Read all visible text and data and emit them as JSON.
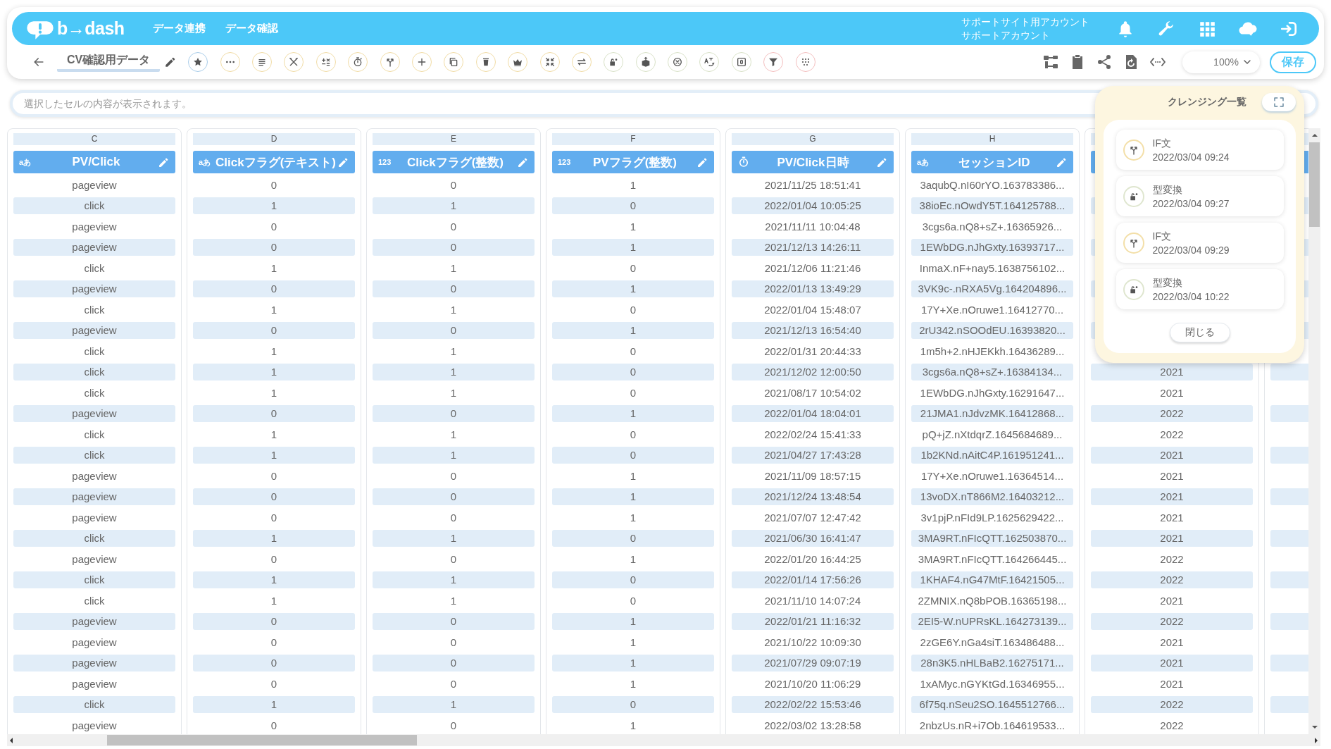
{
  "header": {
    "logo": "b→dash",
    "nav": [
      {
        "label": "データ連携"
      },
      {
        "label": "データ確認"
      }
    ],
    "account": [
      "サポートサイト用アカウント",
      "サポートアカウント"
    ]
  },
  "toolbar": {
    "title": "CV確認用データ",
    "tools": [
      {
        "color": "#a9cdea"
      },
      {
        "color": "#f1dca6"
      },
      {
        "color": "#f1dca6"
      },
      {
        "color": "#f1dca6"
      },
      {
        "color": "#f1dca6"
      },
      {
        "color": "#f1dca6"
      },
      {
        "color": "#f1dca6"
      },
      {
        "color": "#f1dca6"
      },
      {
        "color": "#f1dca6"
      },
      {
        "color": "#f1dca6"
      },
      {
        "color": "#f1dca6"
      },
      {
        "color": "#f1dca6"
      },
      {
        "color": "#f1dca6"
      },
      {
        "color": "#d9e2c8"
      },
      {
        "color": "#d9e2c8"
      },
      {
        "color": "#d9e2c8"
      },
      {
        "color": "#d9e2c8"
      },
      {
        "color": "#d9e2c8"
      },
      {
        "color": "#f4c0c0"
      },
      {
        "color": "#f4c0c0"
      }
    ],
    "zoom": "100%",
    "save": "保存"
  },
  "cell_viewer": {
    "placeholder": "選択したセルの内容が表示されます。"
  },
  "table": {
    "columns": [
      {
        "letter": "C",
        "name": "PV/Click",
        "type_mark": "aあ",
        "cells": [
          "pageview",
          "click",
          "pageview",
          "pageview",
          "click",
          "pageview",
          "click",
          "pageview",
          "click",
          "click",
          "click",
          "pageview",
          "click",
          "click",
          "pageview",
          "pageview",
          "pageview",
          "click",
          "pageview",
          "click",
          "click",
          "pageview",
          "pageview",
          "pageview",
          "pageview",
          "click",
          "pageview"
        ]
      },
      {
        "letter": "D",
        "name": "Clickフラグ(テキスト)",
        "type_mark": "aあ",
        "cells": [
          "0",
          "1",
          "0",
          "0",
          "1",
          "0",
          "1",
          "0",
          "1",
          "1",
          "1",
          "0",
          "1",
          "1",
          "0",
          "0",
          "0",
          "1",
          "0",
          "1",
          "1",
          "0",
          "0",
          "0",
          "0",
          "1",
          "0"
        ]
      },
      {
        "letter": "E",
        "name": "Clickフラグ(整数)",
        "type_mark": "123",
        "cells": [
          "0",
          "1",
          "0",
          "0",
          "1",
          "0",
          "1",
          "0",
          "1",
          "1",
          "1",
          "0",
          "1",
          "1",
          "0",
          "0",
          "0",
          "1",
          "0",
          "1",
          "1",
          "0",
          "0",
          "0",
          "0",
          "1",
          "0"
        ]
      },
      {
        "letter": "F",
        "name": "PVフラグ(整数)",
        "type_mark": "123",
        "cells": [
          "1",
          "0",
          "1",
          "1",
          "0",
          "1",
          "0",
          "1",
          "0",
          "0",
          "0",
          "1",
          "0",
          "0",
          "1",
          "1",
          "1",
          "0",
          "1",
          "0",
          "0",
          "1",
          "1",
          "1",
          "1",
          "0",
          "1"
        ]
      },
      {
        "letter": "G",
        "name": "PV/Click日時",
        "kind": "datetime",
        "cells": [
          "2021/11/25 18:51:41",
          "2022/01/04 10:05:25",
          "2021/11/11 10:04:48",
          "2021/12/13 14:26:11",
          "2021/12/06 11:21:46",
          "2022/01/13 13:49:29",
          "2022/01/04 15:48:07",
          "2021/12/13 16:54:40",
          "2022/01/31 20:44:33",
          "2021/12/02 12:00:50",
          "2021/08/17 10:54:02",
          "2022/01/04 18:04:01",
          "2022/02/24 15:41:33",
          "2021/04/27 17:43:28",
          "2021/11/09 18:57:15",
          "2021/12/24 13:48:54",
          "2021/07/07 12:47:42",
          "2021/06/30 16:41:47",
          "2022/01/20 16:44:25",
          "2022/01/14 17:56:26",
          "2021/11/10 14:07:24",
          "2022/01/21 11:16:32",
          "2021/10/22 10:09:30",
          "2021/07/29 09:07:19",
          "2021/10/20 11:06:29",
          "2022/02/22 15:53:46",
          "2022/03/02 13:28:58"
        ]
      },
      {
        "letter": "H",
        "name": "セッションID",
        "type_mark": "aあ",
        "cells": [
          "3aqubQ.nI60rYO.163783386...",
          "38ioEc.nOwdY5T.164125788...",
          "3cgs6a.nQ8+sZ+.16365926...",
          "1EWbDG.nJhGxty.16393717...",
          "InmaX.nF+nay5.1638756102...",
          "3VK9c-.nRXA5Vg.164204896...",
          "17Y+Xe.nOruwe1.16412770...",
          "2rU342.nSOOdEU.16393820...",
          "1m5h+2.nHJEKkh.16436289...",
          "3cgs6a.nQ8+sZ+.16384134...",
          "1EWbDG.nJhGxty.16291647...",
          "21JMA1.nJdvzMK.16412868...",
          "pQ+jZ.nXtdqrZ.1645684689...",
          "1b2KNd.nAitC4P.161951241...",
          "17Y+Xe.nOruwe1.16364514...",
          "13voDX.nT866M2.16403212...",
          "3v1pjP.nFId9LP.1625629422...",
          "3MA9RT.nFIcQTT.162503870...",
          "3MA9RT.nFIcQTT.164266445...",
          "1KHAF4.nG47MtF.16421505...",
          "2ZMNIX.nQ8bPOB.16365198...",
          "2EI5-W.nUPRsKL.164273139...",
          "2zGE6Y.nGa4siT.163486488...",
          "28n3K5.nHLBaB2.16275171...",
          "1xAMyc.nGYKtGd.16346955...",
          "6f75q.nSeu2SO.1645512766...",
          "2nbzUs.nR+i7Ob.164619533..."
        ]
      },
      {
        "cells": [
          null,
          null,
          null,
          null,
          null,
          null,
          null,
          null,
          null,
          "2021",
          "2021",
          "2022",
          "2022",
          "2021",
          "2021",
          "2021",
          "2021",
          "2021",
          "2022",
          "2022",
          "2021",
          "2022",
          "2021",
          "2021",
          "2021",
          "2022",
          "2022"
        ]
      },
      {
        "kind": "blank"
      }
    ]
  },
  "cleansing_panel": {
    "title": "クレンジング一覧",
    "items": [
      {
        "kind": "if",
        "name": "IF文",
        "time": "2022/03/04 09:24"
      },
      {
        "kind": "convert",
        "name": "型変換",
        "time": "2022/03/04 09:27"
      },
      {
        "kind": "if",
        "name": "IF文",
        "time": "2022/03/04 09:29"
      },
      {
        "kind": "convert",
        "name": "型変換",
        "time": "2022/03/04 10:22"
      }
    ],
    "close": "閉じる"
  }
}
